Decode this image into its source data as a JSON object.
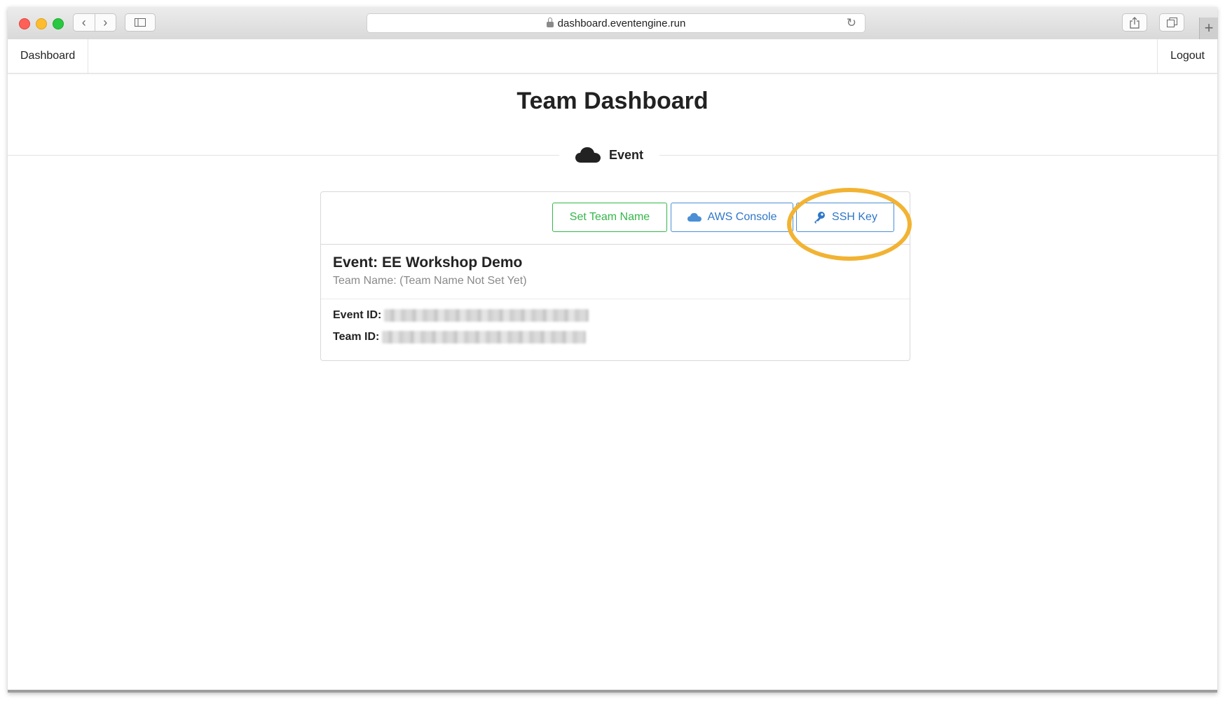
{
  "browser": {
    "url": "dashboard.eventengine.run",
    "back_glyph": "‹",
    "forward_glyph": "›",
    "reload_glyph": "↻",
    "newtab_glyph": "+"
  },
  "navbar": {
    "dashboard_label": "Dashboard",
    "logout_label": "Logout"
  },
  "page": {
    "title": "Team Dashboard",
    "section_label": "Event"
  },
  "actions": {
    "set_team_name": "Set Team Name",
    "aws_console": "AWS Console",
    "ssh_key": "SSH Key"
  },
  "event": {
    "title_prefix": "Event:",
    "title_value": "EE Workshop Demo",
    "team_name_line": "Team Name: (Team Name Not Set Yet)",
    "event_id_label": "Event ID:",
    "team_id_label": "Team ID:"
  },
  "colors": {
    "green": "#35b64a",
    "blue": "#2f77c8",
    "highlight": "#f2b333"
  }
}
